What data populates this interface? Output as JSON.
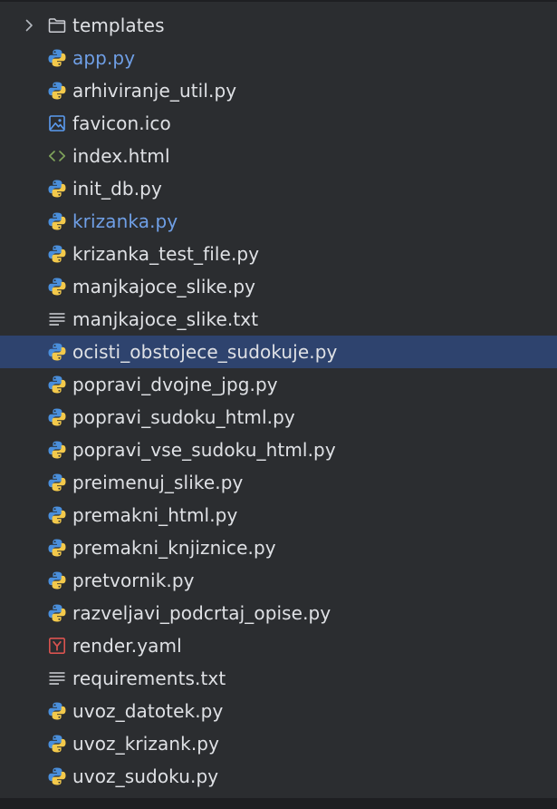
{
  "tree": {
    "items": [
      {
        "name": "templates",
        "type": "folder",
        "icon": "folder-icon",
        "collapsed": true
      },
      {
        "name": "app.py",
        "type": "python",
        "icon": "python-icon",
        "modified": true
      },
      {
        "name": "arhiviranje_util.py",
        "type": "python",
        "icon": "python-icon"
      },
      {
        "name": "favicon.ico",
        "type": "image",
        "icon": "image-icon"
      },
      {
        "name": "index.html",
        "type": "html",
        "icon": "html-icon"
      },
      {
        "name": "init_db.py",
        "type": "python",
        "icon": "python-icon"
      },
      {
        "name": "krizanka.py",
        "type": "python",
        "icon": "python-icon",
        "modified": true
      },
      {
        "name": "krizanka_test_file.py",
        "type": "python",
        "icon": "python-icon"
      },
      {
        "name": "manjkajoce_slike.py",
        "type": "python",
        "icon": "python-icon"
      },
      {
        "name": "manjkajoce_slike.txt",
        "type": "text",
        "icon": "text-file-icon"
      },
      {
        "name": "ocisti_obstojece_sudokuje.py",
        "type": "python",
        "icon": "python-icon",
        "selected": true
      },
      {
        "name": "popravi_dvojne_jpg.py",
        "type": "python",
        "icon": "python-icon"
      },
      {
        "name": "popravi_sudoku_html.py",
        "type": "python",
        "icon": "python-icon"
      },
      {
        "name": "popravi_vse_sudoku_html.py",
        "type": "python",
        "icon": "python-icon"
      },
      {
        "name": "preimenuj_slike.py",
        "type": "python",
        "icon": "python-icon"
      },
      {
        "name": "premakni_html.py",
        "type": "python",
        "icon": "python-icon"
      },
      {
        "name": "premakni_knjiznice.py",
        "type": "python",
        "icon": "python-icon"
      },
      {
        "name": "pretvornik.py",
        "type": "python",
        "icon": "python-icon"
      },
      {
        "name": "razveljavi_podcrtaj_opise.py",
        "type": "python",
        "icon": "python-icon"
      },
      {
        "name": "render.yaml",
        "type": "yaml",
        "icon": "yaml-icon"
      },
      {
        "name": "requirements.txt",
        "type": "text",
        "icon": "text-file-icon"
      },
      {
        "name": "uvoz_datotek.py",
        "type": "python",
        "icon": "python-icon"
      },
      {
        "name": "uvoz_krizank.py",
        "type": "python",
        "icon": "python-icon"
      },
      {
        "name": "uvoz_sudoku.py",
        "type": "python",
        "icon": "python-icon"
      }
    ]
  },
  "colors": {
    "background": "#2b2d30",
    "selection": "#2e436e",
    "text": "#dfe1e5",
    "modified_text": "#6f9fe6",
    "python_blue": "#4a8fdc",
    "python_yellow": "#f3c94b",
    "html_green": "#7fa35b",
    "yaml_red": "#d9534f"
  }
}
